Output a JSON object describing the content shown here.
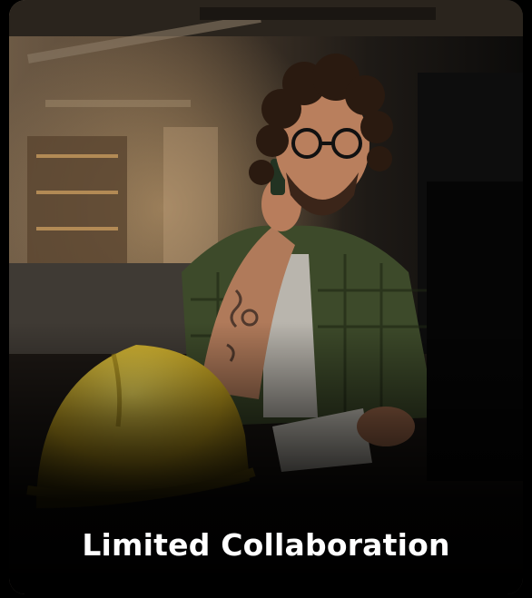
{
  "card": {
    "title": "Limited Collaboration",
    "accent_color": "#ffffff"
  }
}
